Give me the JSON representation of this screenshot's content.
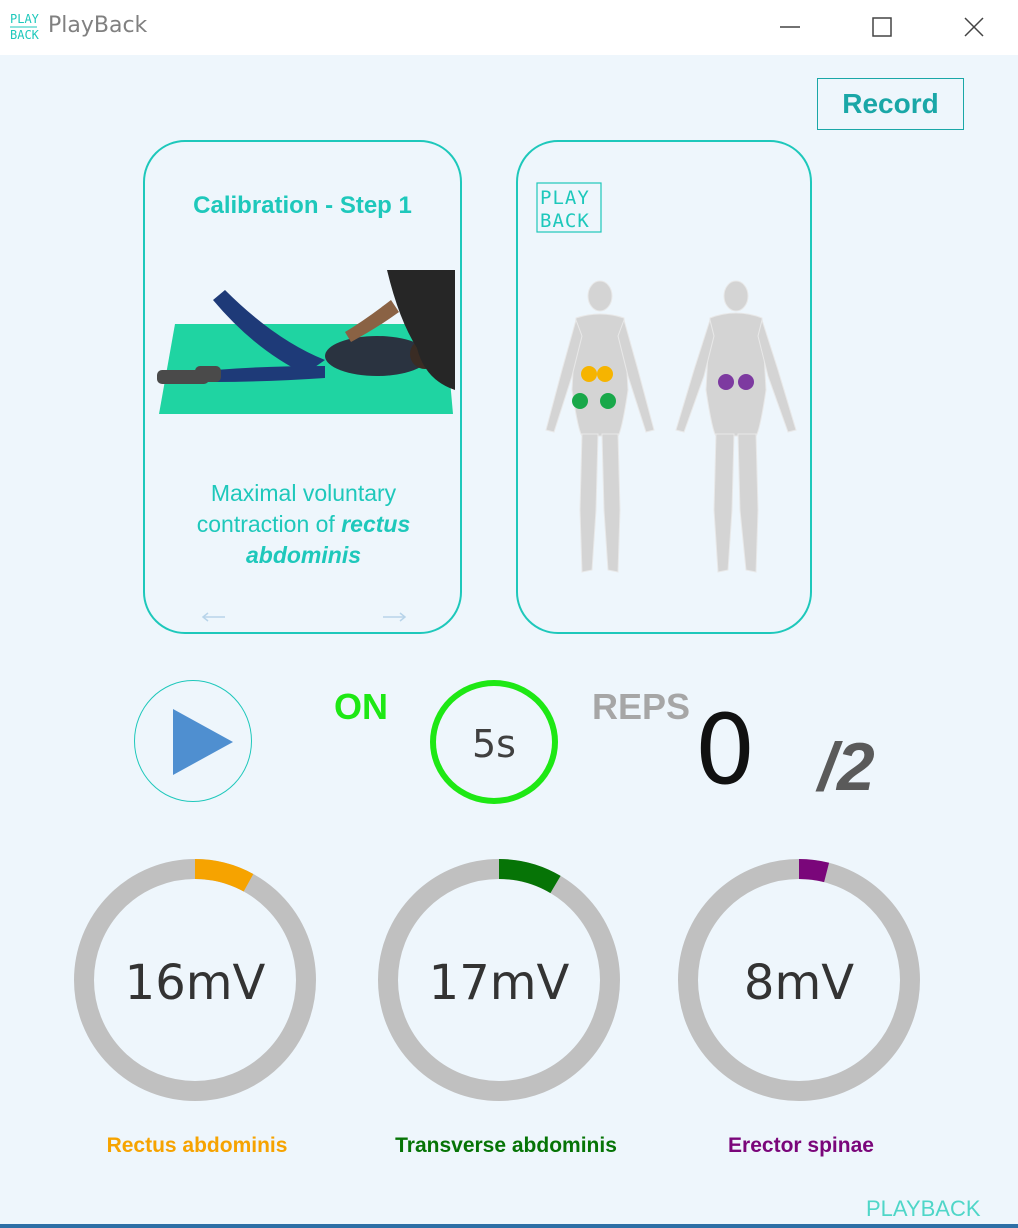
{
  "window": {
    "title": "PlayBack",
    "logo_line1": "PLAY",
    "logo_line2": "BACK"
  },
  "toolbar": {
    "record_label": "Record"
  },
  "calibration_card": {
    "title": "Calibration - Step 1",
    "instruction_prefix": "Maximal voluntary contraction of ",
    "instruction_muscle": "rectus abdominis"
  },
  "muscle_map_card": {
    "logo_line1": "PLAY",
    "logo_line2": "BACK"
  },
  "session": {
    "state_label": "ON",
    "timer": "5s",
    "reps_label": "REPS",
    "reps_count": "0",
    "reps_total": "/2"
  },
  "gauges": [
    {
      "value": "16mV",
      "label": "Rectus abdominis",
      "color": "#f6a300",
      "level": 0.08
    },
    {
      "value": "17mV",
      "label": "Transverse abdominis",
      "color": "#067406",
      "level": 0.085
    },
    {
      "value": "8mV",
      "label": "Erector spinae",
      "color": "#7a067a",
      "level": 0.04
    }
  ],
  "colors": {
    "accent": "#1ec8bb",
    "active": "#1ee814",
    "ring_track": "#c0c0c0"
  },
  "footer": {
    "brand": "PLAYBACK"
  }
}
